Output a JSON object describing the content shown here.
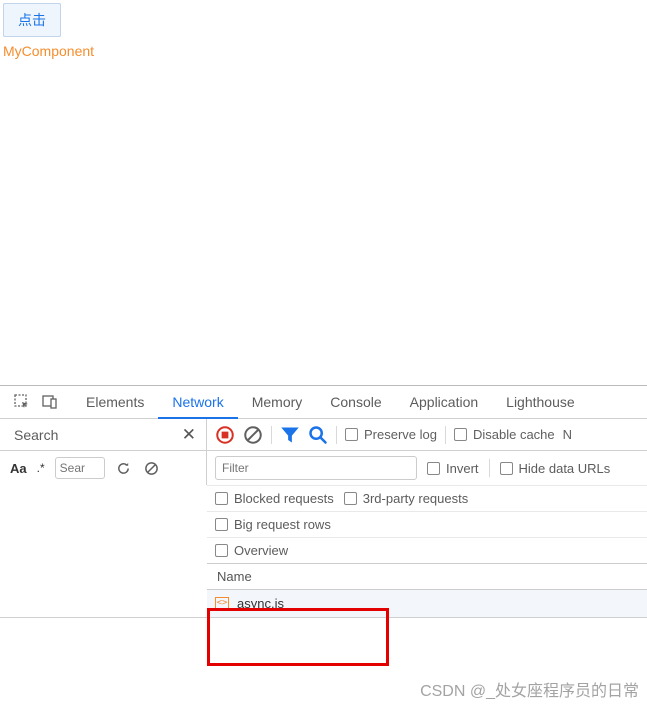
{
  "page": {
    "button_label": "点击",
    "component_label": "MyComponent"
  },
  "devtools": {
    "tabs": {
      "elements": "Elements",
      "network": "Network",
      "memory": "Memory",
      "console": "Console",
      "application": "Application",
      "lighthouse": "Lighthouse"
    },
    "search_panel": {
      "title": "Search",
      "input_placeholder": "Sear",
      "case_label": "Aa",
      "regex_label": ".*"
    },
    "toolbar": {
      "preserve_log": "Preserve log",
      "disable_cache": "Disable cache",
      "n_truncated": "N"
    },
    "filters": {
      "filter_placeholder": "Filter",
      "invert": "Invert",
      "hide_data_urls": "Hide data URLs",
      "blocked_requests": "Blocked requests",
      "third_party": "3rd-party requests",
      "big_rows": "Big request rows",
      "overview": "Overview"
    },
    "table": {
      "name_header": "Name",
      "rows": [
        {
          "filename": "async.js"
        }
      ]
    }
  },
  "watermark": "CSDN @_处女座程序员的日常"
}
